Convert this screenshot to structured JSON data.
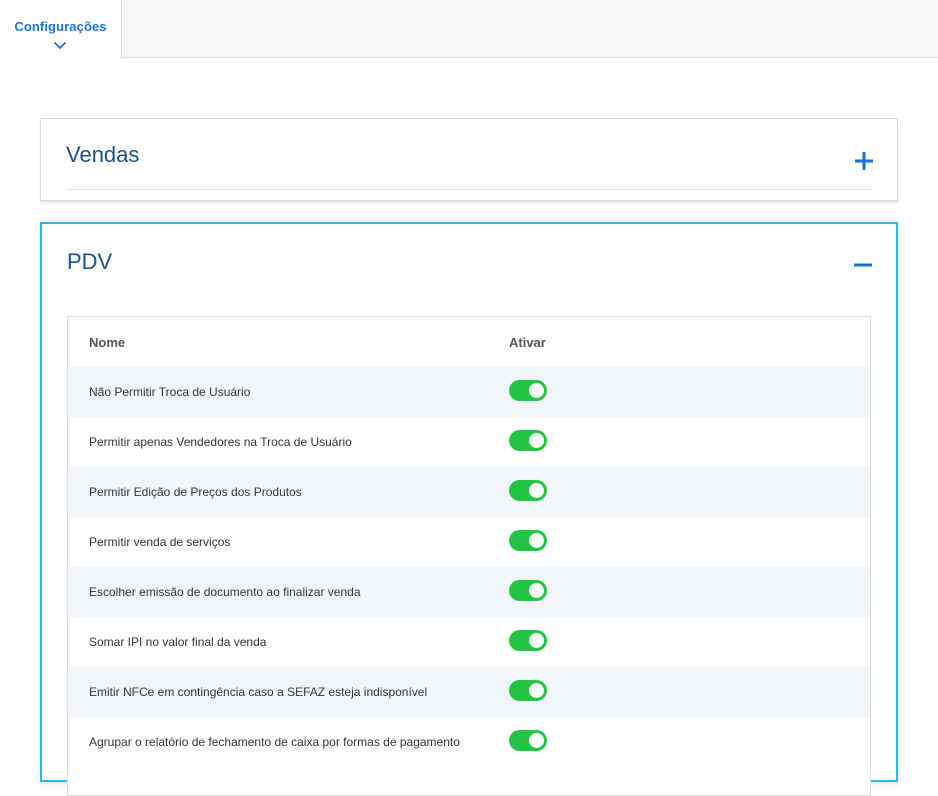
{
  "header": {
    "active_tab": "Configurações",
    "active_tab_icon": "chevron-down-icon"
  },
  "sections": {
    "vendas": {
      "title": "Vendas",
      "expanded": false,
      "toggle_icon": "plus-icon"
    },
    "pdv": {
      "title": "PDV",
      "expanded": true,
      "toggle_icon": "minus-icon",
      "table": {
        "columns": {
          "nome": "Nome",
          "ativar": "Ativar"
        },
        "rows": [
          {
            "label": "Não Permitir Troca de Usuário",
            "enabled": true
          },
          {
            "label": "Permitir apenas Vendedores na Troca de Usuário",
            "enabled": true
          },
          {
            "label": "Permitir Edição de Preços dos Produtos",
            "enabled": true
          },
          {
            "label": "Permitir venda de serviços",
            "enabled": true
          },
          {
            "label": "Escolher emissão de documento ao finalizar venda",
            "enabled": true
          },
          {
            "label": "Somar IPI no valor final da venda",
            "enabled": true
          },
          {
            "label": "Emitir NFCe em contingência caso a SEFAZ esteja indisponível",
            "enabled": true
          },
          {
            "label": "Agrupar o relatório de fechamento de caixa por formas de pagamento",
            "enabled": true
          }
        ]
      }
    }
  },
  "colors": {
    "accent": "#1a73d9",
    "title": "#1e4f86",
    "active_border": "#29b6e8",
    "toggle_on": "#22c542",
    "row_stripe": "#f2f5fa"
  }
}
